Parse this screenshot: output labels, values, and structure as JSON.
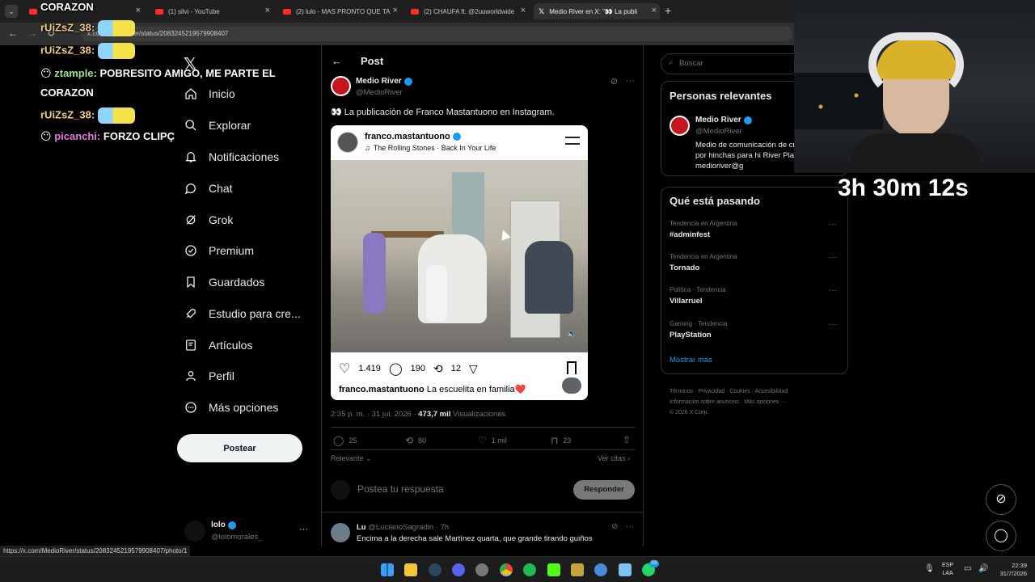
{
  "browser": {
    "tabs": [
      {
        "label": "(1) silvi - YouTube"
      },
      {
        "label": "(2) lulo - MAS PRONTO QUE TA"
      },
      {
        "label": "(2) CHAUFA ft. @2uuworldwide"
      },
      {
        "label": "Medio River en X: \"👀 La publi"
      }
    ],
    "new_tab_icon": "+",
    "url": "x.com/MedioRiver/status/2083245219579908407",
    "status_url": "https://x.com/MedioRiver/status/2083245219579908407/photo/1"
  },
  "overlay": {
    "chat": [
      {
        "user": "CORAZON",
        "text": ""
      },
      {
        "user": "rUiZsZ_38:",
        "text": ""
      },
      {
        "user": "rUiZsZ_38:",
        "text": ""
      },
      {
        "user": "ztample:",
        "text": "POBRESITO AMIGO, ME PARTE EL"
      },
      {
        "user": "",
        "text": "CORAZON"
      },
      {
        "user": "rUiZsZ_38:",
        "text": ""
      },
      {
        "user": "picanchi:",
        "text": "FORZO CLIPÇ"
      }
    ],
    "timer": "3h 30m 12s"
  },
  "sidebar": {
    "items": [
      {
        "label": "Inicio",
        "icon": "home-icon"
      },
      {
        "label": "Explorar",
        "icon": "search-icon"
      },
      {
        "label": "Notificaciones",
        "icon": "bell-icon"
      },
      {
        "label": "Chat",
        "icon": "chat-icon"
      },
      {
        "label": "Grok",
        "icon": "grok-icon"
      },
      {
        "label": "Premium",
        "icon": "premium-icon"
      },
      {
        "label": "Guardados",
        "icon": "bookmark-icon"
      },
      {
        "label": "Estudio para cre...",
        "icon": "rocket-icon"
      },
      {
        "label": "Artículos",
        "icon": "article-icon"
      },
      {
        "label": "Perfil",
        "icon": "person-icon"
      },
      {
        "label": "Más opciones",
        "icon": "more-icon"
      }
    ],
    "post_button": "Postear",
    "account": {
      "name": "lolo",
      "handle": "@lolomorales_"
    }
  },
  "post": {
    "header": "Post",
    "author": {
      "name": "Medio River",
      "handle": "@MedioRiver"
    },
    "text": "👀 La publicación de Franco Mastantuono en Instagram.",
    "instagram": {
      "username": "franco.mastantuono",
      "song": "The Rolling Stones · Back In Your Life",
      "likes": "1.419",
      "comments": "190",
      "reposts": "12",
      "caption_user": "franco.mastantuono",
      "caption": "La escuelita en familia❤️"
    },
    "meta": {
      "time": "2:35 p. m. · 31 jul. 2026 · ",
      "views": "473,7 mil",
      "views_label": "Visualizaciones"
    },
    "actions": {
      "replies": "25",
      "reposts": "80",
      "likes": "1 mil",
      "bookmarks": "23"
    },
    "sort_label": "Relevante",
    "quotes_label": "Ver citas",
    "reply_placeholder": "Postea tu respuesta",
    "reply_button": "Responder"
  },
  "reply": {
    "name": "Lu",
    "handle": "@LucianoSagradin · 7h",
    "text": "Encima a la derecha sale Martínez quarta, que grande tirando guiños"
  },
  "right": {
    "search_placeholder": "Buscar",
    "relevant_title": "Personas relevantes",
    "relevant": {
      "name": "Medio River",
      "handle": "@MedioRiver",
      "bio": "Medio de comunicación de creado por hinchas para hi River Plate. | medioriver@g"
    },
    "trending_title": "Qué está pasando",
    "trends": [
      {
        "category": "Tendencia en Argentina",
        "name": "#adminfest"
      },
      {
        "category": "Tendencia en Argentina",
        "name": "Tornado"
      },
      {
        "category": "Política · Tendencia",
        "name": "Villarruel"
      },
      {
        "category": "Gaming · Tendencia",
        "name": "PlayStation"
      }
    ],
    "show_more": "Mostrar más",
    "footer": [
      "Términos",
      "Privacidad",
      "Cookies",
      "Accesibilidad",
      "Información sobre anuncios",
      "Más opciones ···",
      "© 2026 X Corp."
    ]
  },
  "taskbar": {
    "lang": "ESP",
    "lang2": "LAA",
    "time": "22:39",
    "date": "31/7/2026",
    "badge": "53"
  },
  "colors": {
    "accent": "#1d9bf0",
    "verified": "#1d9bf0",
    "heart": "#e0245e"
  }
}
